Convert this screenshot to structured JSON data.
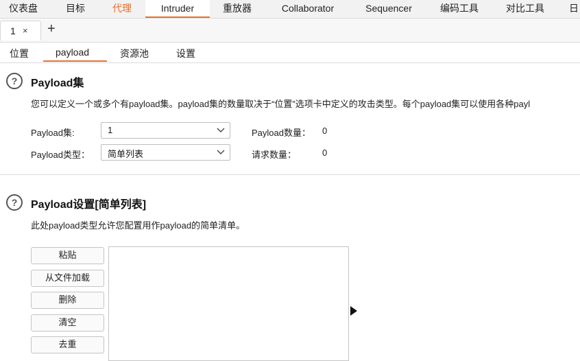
{
  "top_menu": {
    "items": [
      "仪表盘",
      "目标",
      "代理",
      "Intruder",
      "重放器",
      "Collaborator",
      "Sequencer",
      "编码工具",
      "对比工具",
      "日"
    ],
    "active": "Intruder",
    "highlighted": "代理"
  },
  "request_tabs": {
    "tab_label": "1",
    "close_glyph": "×",
    "add_glyph": "+"
  },
  "sub_tabs": {
    "items": [
      "位置",
      "payload",
      "资源池",
      "设置"
    ],
    "active": "payload"
  },
  "payload_sets": {
    "help_glyph": "?",
    "title": "Payload集",
    "description": "您可以定义一个或多个有payload集。payload集的数量取决于“位置”选项卡中定义的攻击类型。每个payload集可以使用各种payl",
    "set_label": "Payload集:",
    "set_value": "1",
    "type_label": "Payload类型：",
    "type_value": "简单列表",
    "count_label": "Payload数量：",
    "count_value": "0",
    "requests_label": "请求数量：",
    "requests_value": "0"
  },
  "payload_settings": {
    "help_glyph": "?",
    "title": "Payload设置[简单列表]",
    "description": "此处payload类型允许您配置用作payload的简单清单。",
    "buttons": [
      "粘贴",
      "从文件加载",
      "删除",
      "清空",
      "去重"
    ]
  },
  "colors": {
    "accent": "#e8702a",
    "bar_bg": "#f2f2f2"
  }
}
